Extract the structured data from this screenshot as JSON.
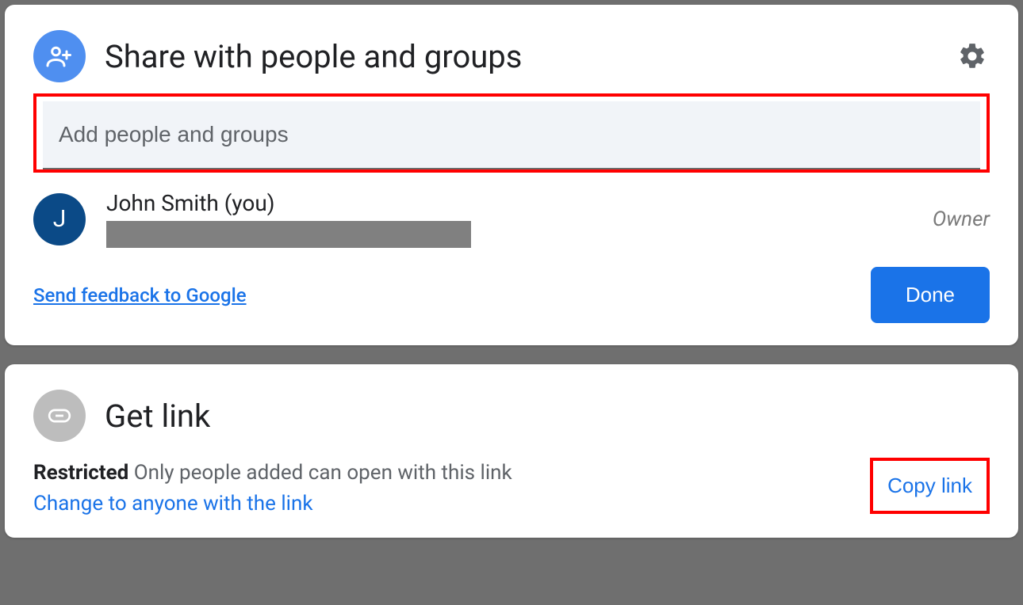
{
  "share": {
    "title": "Share with people and groups",
    "input_placeholder": "Add people and groups",
    "person": {
      "initial": "J",
      "name": "John Smith (you)",
      "role": "Owner"
    },
    "feedback": "Send feedback to Google",
    "done": "Done"
  },
  "getlink": {
    "title": "Get link",
    "restricted_label": "Restricted",
    "restricted_desc": " Only people added can open with this link",
    "change": "Change to anyone with the link",
    "copy": "Copy link"
  }
}
